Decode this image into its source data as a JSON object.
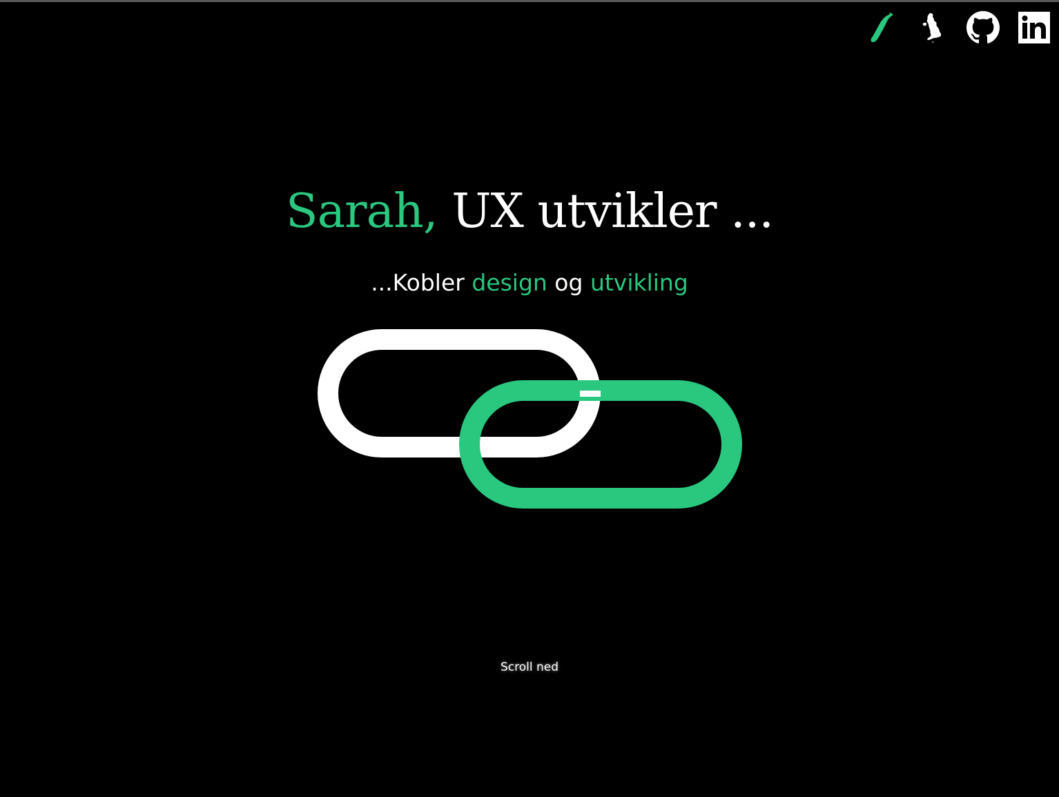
{
  "nav": {
    "icons": [
      {
        "name": "norway-map-icon",
        "color": "#2ac77f"
      },
      {
        "name": "uk-map-icon",
        "color": "#ffffff"
      },
      {
        "name": "github-icon",
        "color": "#ffffff"
      },
      {
        "name": "linkedin-icon",
        "color": "#ffffff"
      }
    ]
  },
  "hero": {
    "name": "Sarah,",
    "role": " UX utvikler ..."
  },
  "tagline": {
    "prefix": "...Kobler ",
    "word1": "design",
    "joiner": " og ",
    "word2": "utvikling"
  },
  "graphic": {
    "icon": "chain-link-icon",
    "link1_color": "#ffffff",
    "link2_color": "#2ac77f"
  },
  "scroll_hint": "Scroll ned",
  "colors": {
    "background": "#000000",
    "accent": "#2ac77f",
    "text": "#ffffff"
  }
}
